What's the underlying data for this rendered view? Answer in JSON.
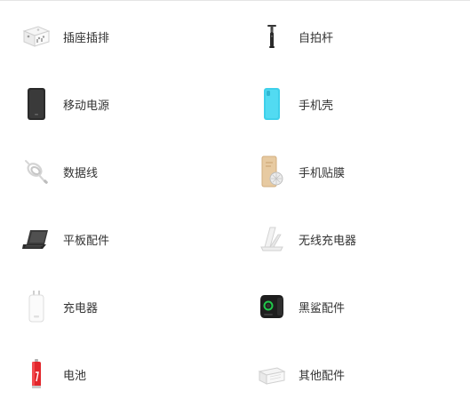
{
  "categories": [
    {
      "label": "插座插排",
      "icon": "power-strip-icon"
    },
    {
      "label": "自拍杆",
      "icon": "selfie-stick-icon"
    },
    {
      "label": "移动电源",
      "icon": "power-bank-icon"
    },
    {
      "label": "手机壳",
      "icon": "phone-case-icon"
    },
    {
      "label": "数据线",
      "icon": "data-cable-icon"
    },
    {
      "label": "手机贴膜",
      "icon": "screen-protector-icon"
    },
    {
      "label": "平板配件",
      "icon": "tablet-keyboard-icon"
    },
    {
      "label": "无线充电器",
      "icon": "wireless-charger-icon"
    },
    {
      "label": "充电器",
      "icon": "charger-icon"
    },
    {
      "label": "黑鲨配件",
      "icon": "gamepad-icon"
    },
    {
      "label": "电池",
      "icon": "battery-icon"
    },
    {
      "label": "其他配件",
      "icon": "other-accessories-icon"
    }
  ]
}
